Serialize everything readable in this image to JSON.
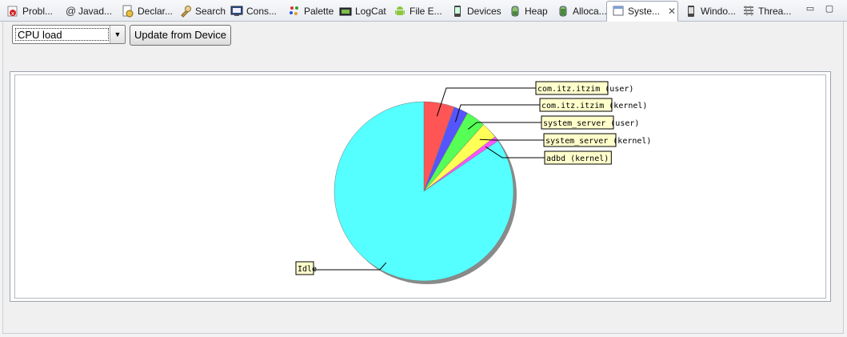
{
  "tabs": [
    {
      "label": "Probl...",
      "icon": "problems-icon",
      "active": false
    },
    {
      "label": "Javad...",
      "icon": "javadoc-icon",
      "active": false
    },
    {
      "label": "Declar...",
      "icon": "declaration-icon",
      "active": false
    },
    {
      "label": "Search",
      "icon": "search-icon",
      "active": false
    },
    {
      "label": "Cons...",
      "icon": "console-icon",
      "active": false
    },
    {
      "label": "Palette",
      "icon": "palette-icon",
      "active": false
    },
    {
      "label": "LogCat",
      "icon": "logcat-icon",
      "active": false
    },
    {
      "label": "File E...",
      "icon": "android-icon",
      "active": false
    },
    {
      "label": "Devices",
      "icon": "device-icon",
      "active": false
    },
    {
      "label": "Heap",
      "icon": "heap-icon",
      "active": false
    },
    {
      "label": "Alloca...",
      "icon": "allocation-icon",
      "active": false
    },
    {
      "label": "Syste...",
      "icon": "system-icon",
      "active": true
    },
    {
      "label": "Windo...",
      "icon": "window-icon",
      "active": false
    },
    {
      "label": "Threa...",
      "icon": "threads-icon",
      "active": false
    }
  ],
  "toolbar": {
    "selector_value": "CPU load",
    "update_button": "Update from Device"
  },
  "chart_data": {
    "type": "pie",
    "title": "",
    "slices": [
      {
        "label": "com.itz.itzim (user)",
        "value": 5.5,
        "color": "#ff5555"
      },
      {
        "label": "com.itz.itzim (kernel)",
        "value": 2.6,
        "color": "#5555ff"
      },
      {
        "label": "system_server (user)",
        "value": 3.5,
        "color": "#55ff55"
      },
      {
        "label": "system_server (kernel)",
        "value": 3.0,
        "color": "#ffff55"
      },
      {
        "label": "adbd (kernel)",
        "value": 0.9,
        "color": "#ff55ff"
      },
      {
        "label": "Idle",
        "value": 84.5,
        "color": "#55ffff"
      }
    ]
  }
}
